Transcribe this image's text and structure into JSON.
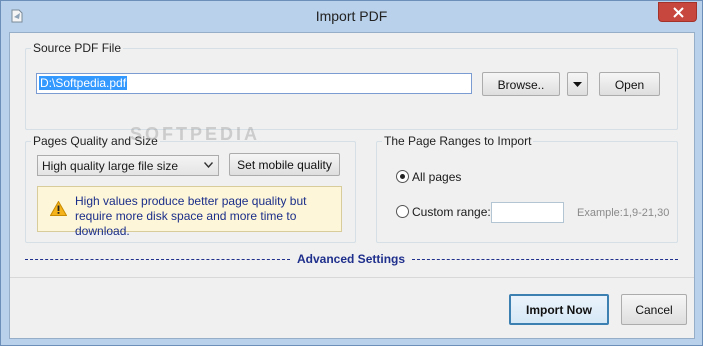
{
  "window": {
    "title": "Import PDF"
  },
  "source": {
    "group_label": "Source PDF File",
    "path_value": "D:\\Softpedia.pdf",
    "browse_label": "Browse..",
    "open_label": "Open"
  },
  "quality": {
    "group_label": "Pages Quality and Size",
    "selected_option": "High quality large file size",
    "mobile_label": "Set mobile quality",
    "warning": "High values produce better page quality but require more disk space and more time to download."
  },
  "ranges": {
    "group_label": "The Page Ranges to Import",
    "all_pages_label": "All pages",
    "all_pages_checked": true,
    "custom_label": "Custom range:",
    "custom_value": "",
    "example": "Example:1,9-21,30"
  },
  "advanced": {
    "label": "Advanced Settings"
  },
  "actions": {
    "import_label": "Import Now",
    "cancel_label": "Cancel"
  },
  "watermark": "SOFTPEDIA",
  "colors": {
    "accent": "#1f2f8c",
    "selection": "#3399ff",
    "close": "#c7463e",
    "warning_bg": "#fdf6d8"
  }
}
